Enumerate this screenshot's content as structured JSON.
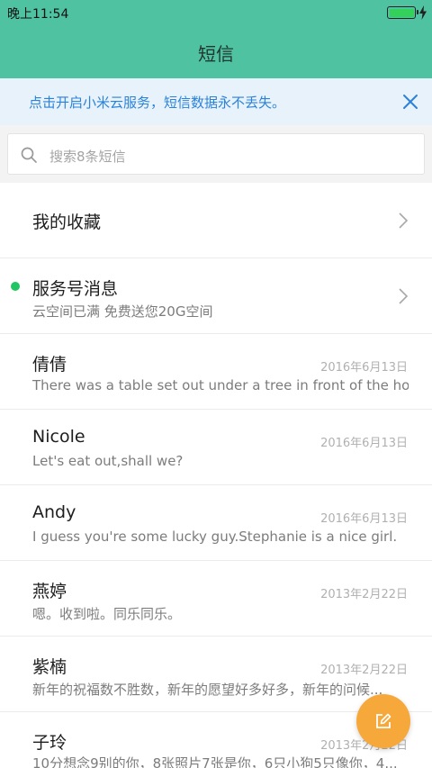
{
  "status_bar": {
    "time": "晚上11:54"
  },
  "header": {
    "title": "短信"
  },
  "banner": {
    "text": "点击开启小米云服务，短信数据永不丢失。"
  },
  "search": {
    "placeholder": "搜索8条短信"
  },
  "favorites": {
    "label": "我的收藏"
  },
  "service": {
    "title": "服务号消息",
    "preview": "云空间已满 免费送您20G空间"
  },
  "conversations": [
    {
      "name": "倩倩",
      "date": "2016年6月13日",
      "preview": "There was a table set out under a tree in front of the ho..."
    },
    {
      "name": "Nicole",
      "date": "2016年6月13日",
      "preview": "Let's eat out,shall we?"
    },
    {
      "name": "Andy",
      "date": "2016年6月13日",
      "preview": "I guess you're some lucky guy.Stephanie is a nice girl."
    },
    {
      "name": "燕婷",
      "date": "2013年2月22日",
      "preview": "嗯。收到啦。同乐同乐。"
    },
    {
      "name": "紫楠",
      "date": "2013年2月22日",
      "preview": "新年的祝福数不胜数，新年的愿望好多好多，新年的问候..."
    },
    {
      "name": "子玲",
      "date": "2013年2月22日",
      "preview": "10分想念9别的你，8张照片7张是你，6只小狗5只像你，4..."
    }
  ],
  "colors": {
    "header": "#4fc3a1",
    "accent_blue": "#2b82d9",
    "fab": "#f7a83a",
    "unread_dot": "#21c562"
  }
}
